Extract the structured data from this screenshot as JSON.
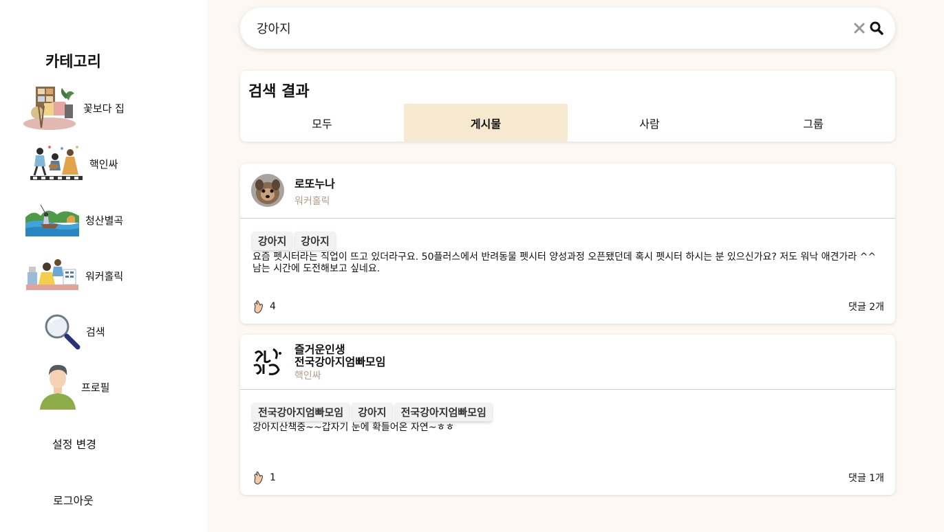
{
  "sidebar": {
    "title": "카테고리",
    "categories": [
      {
        "label": "꽃보다 집",
        "icon": "house-plants-illustration"
      },
      {
        "label": "핵인싸",
        "icon": "party-people-illustration"
      },
      {
        "label": "청산별곡",
        "icon": "fishing-landscape-illustration"
      },
      {
        "label": "워커홀릭",
        "icon": "office-worker-illustration"
      },
      {
        "label": "검색",
        "icon": "magnifier-illustration"
      },
      {
        "label": "프로필",
        "icon": "profile-person-illustration"
      }
    ],
    "settings_label": "설정 변경",
    "logout_label": "로그아웃"
  },
  "search": {
    "value": "강아지",
    "placeholder": ""
  },
  "results": {
    "title": "검색 결과",
    "tabs": [
      {
        "label": "모두"
      },
      {
        "label": "게시물"
      },
      {
        "label": "사람"
      },
      {
        "label": "그룹"
      }
    ],
    "active_tab": "게시물"
  },
  "posts": [
    {
      "author": "로또누나",
      "category": "워커홀릭",
      "tags": [
        "강아지",
        "강아지"
      ],
      "content": "요즘 펫시터라는 직업이 뜨고 있더라구요. 50플러스에서 반려동물 펫시터 양성과정 오픈됐던데 혹시 펫시터 하시는 분 있으신가요? 저도 워낙 애견가라 ^^ 남는 시간에 도전해보고 싶네요.",
      "likes": "4",
      "comments": "댓글 2개"
    },
    {
      "author_line1": "즐거운인생",
      "author_line2": "전국강아지엄빠모임",
      "category": "핵인싸",
      "tags": [
        "전국강아지엄빠모임",
        "강아지",
        "전국강아지엄빠모임"
      ],
      "content": "강아지산책중~~갑자기 눈에 확들어온 자연~ㅎㅎ",
      "likes": "1",
      "comments": "댓글 1개"
    }
  ],
  "colors": {
    "page_bg": "#fdf8f4",
    "active_tab_bg": "#f7e9cf",
    "category_text": "#b59c86"
  }
}
